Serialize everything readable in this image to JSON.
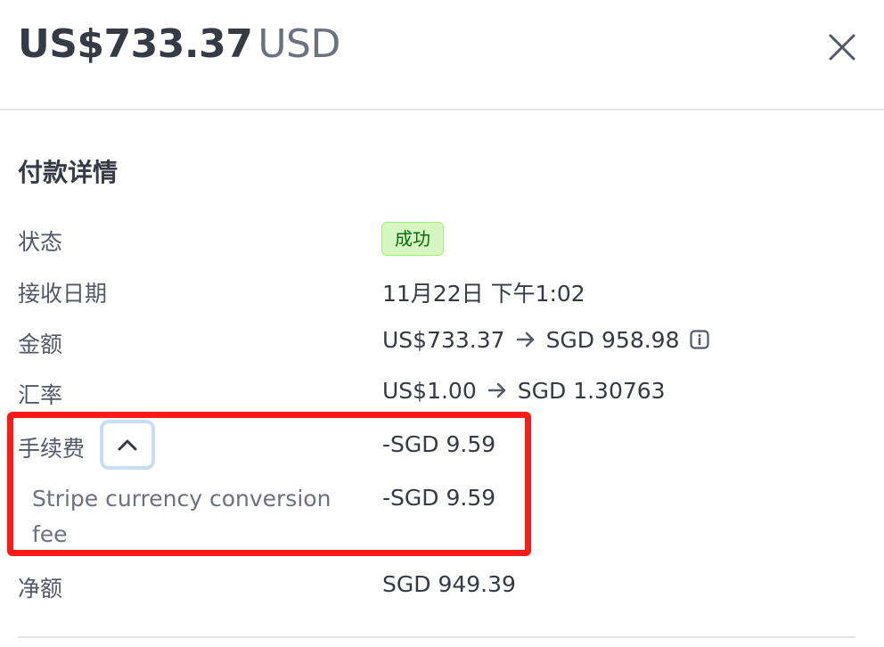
{
  "header": {
    "amount": "US$733.37",
    "currency": "USD"
  },
  "section": {
    "title": "付款详情"
  },
  "rows": {
    "status": {
      "label": "状态",
      "value": "成功"
    },
    "date": {
      "label": "接收日期",
      "value": "11月22日 下午1:02"
    },
    "amount": {
      "label": "金额",
      "from": "US$733.37",
      "to": "SGD 958.98"
    },
    "rate": {
      "label": "汇率",
      "from": "US$1.00",
      "to": "SGD 1.30763"
    },
    "fee": {
      "label": "手续费",
      "value": "-SGD 9.59"
    },
    "fee_detail": {
      "label": "Stripe currency conversion fee",
      "value": "-SGD 9.59"
    },
    "net": {
      "label": "净额",
      "value": "SGD 949.39"
    }
  },
  "icons": {
    "close": "close-icon",
    "info": "info-icon",
    "chevron": "chevron-up-icon",
    "arrow": "arrow-right-icon"
  },
  "colors": {
    "success_bg": "#d7f7c2",
    "success_text": "#05690d",
    "highlight": "#ff1a1a"
  }
}
